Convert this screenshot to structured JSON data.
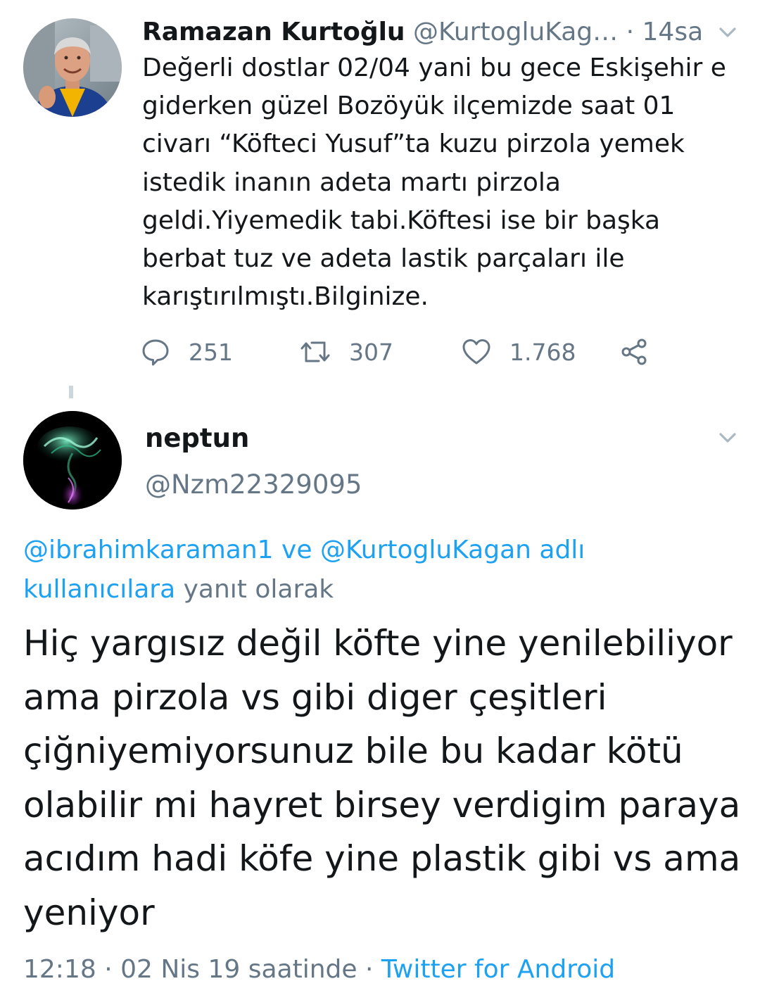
{
  "parent_tweet": {
    "author_name": "Ramazan Kurtoğlu",
    "author_handle": "@KurtogluKag…",
    "separator": "·",
    "time": "14sa",
    "text": "Değerli dostlar 02/04 yani bu gece Eskişehir e giderken güzel Bozöyük ilçemizde saat 01 civarı “Köfteci Yusuf”ta kuzu pirzola yemek istedik inanın adeta martı pirzola geldi.Yiyemedik tabi.Köftesi ise bir başka berbat tuz ve adeta lastik parçaları ile karıştırılmıştı.Bilginize.",
    "reply_count": "251",
    "retweet_count": "307",
    "like_count": "1.768",
    "icons": [
      "reply-icon",
      "retweet-icon",
      "like-icon",
      "share-icon",
      "chevron-down-icon"
    ]
  },
  "reply_tweet": {
    "author_name": "neptun",
    "author_handle": "@Nzm22329095",
    "replying_to": {
      "mention_1": "@ibrahimkaraman1",
      "connector": " ve ",
      "mention_2": "@KurtogluKagan adlı kullanıcılara",
      "suffix": " yanıt olarak"
    },
    "text": "Hiç yargısız değil köfte yine yenilebiliyor ama pirzola vs gibi diger çeşitleri çiğniyemiyorsunuz bile bu kadar kötü olabilir mi hayret birsey verdigim paraya acıdım hadi köfe yine plastik gibi vs ama yeniyor",
    "timestamp": "12:18 · 02 Nis 19 saatinde",
    "meta_separator": " · ",
    "source": "Twitter for Android"
  },
  "colors": {
    "text_primary": "#14171a",
    "text_secondary": "#657786",
    "link": "#1da1f2",
    "divider": "#ccd6dd"
  }
}
